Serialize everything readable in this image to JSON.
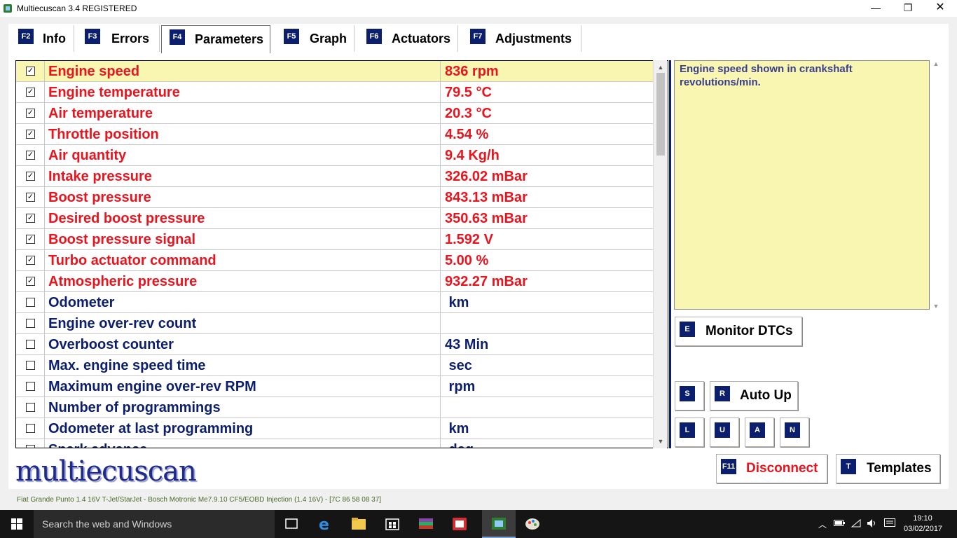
{
  "window": {
    "title": "Multiecuscan 3.4 REGISTERED",
    "min_glyph": "—",
    "max_glyph": "❐",
    "close_glyph": "✕"
  },
  "tabs": [
    {
      "key": "F2",
      "label": "Info",
      "active": false
    },
    {
      "key": "F3",
      "label": "Errors",
      "active": false
    },
    {
      "key": "F4",
      "label": "Parameters",
      "active": true
    },
    {
      "key": "F5",
      "label": "Graph",
      "active": false
    },
    {
      "key": "F6",
      "label": "Actuators",
      "active": false
    },
    {
      "key": "F7",
      "label": "Adjustments",
      "active": false
    }
  ],
  "parameters": [
    {
      "name": "Engine speed",
      "value": "836 rpm",
      "checked": true
    },
    {
      "name": "Engine temperature",
      "value": "79.5 °C",
      "checked": true
    },
    {
      "name": "Air temperature",
      "value": "20.3 °C",
      "checked": true
    },
    {
      "name": "Throttle position",
      "value": "4.54 %",
      "checked": true
    },
    {
      "name": "Air quantity",
      "value": "9.4 Kg/h",
      "checked": true
    },
    {
      "name": "Intake pressure",
      "value": "326.02 mBar",
      "checked": true
    },
    {
      "name": "Boost pressure",
      "value": "843.13 mBar",
      "checked": true
    },
    {
      "name": "Desired boost pressure",
      "value": "350.63 mBar",
      "checked": true
    },
    {
      "name": "Boost pressure signal",
      "value": "1.592 V",
      "checked": true
    },
    {
      "name": "Turbo actuator command",
      "value": "5.00 %",
      "checked": true
    },
    {
      "name": "Atmospheric pressure",
      "value": "932.27 mBar",
      "checked": true
    },
    {
      "name": "Odometer",
      "value": " km",
      "checked": false
    },
    {
      "name": "Engine over-rev count",
      "value": "",
      "checked": false
    },
    {
      "name": "Overboost counter",
      "value": "43 Min",
      "checked": false
    },
    {
      "name": "Max. engine speed time",
      "value": " sec",
      "checked": false
    },
    {
      "name": "Maximum engine over-rev RPM",
      "value": " rpm",
      "checked": false
    },
    {
      "name": "Number of programmings",
      "value": "",
      "checked": false
    },
    {
      "name": "Odometer at last programming",
      "value": " km",
      "checked": false
    },
    {
      "name": "Spark advance",
      "value": " deg",
      "checked": false
    }
  ],
  "selected_parameter_index": 0,
  "description": "Engine speed shown in crankshaft revolutions/min.",
  "buttons": {
    "monitor_dtcs": {
      "key": "E",
      "label": "Monitor DTCs"
    },
    "s": {
      "key": "S"
    },
    "auto_up": {
      "key": "R",
      "label": "Auto Up"
    },
    "l": {
      "key": "L"
    },
    "u": {
      "key": "U"
    },
    "a": {
      "key": "A"
    },
    "n": {
      "key": "N"
    },
    "disconnect": {
      "key": "F11",
      "label": "Disconnect"
    },
    "templates": {
      "key": "T",
      "label": "Templates"
    }
  },
  "logo_text": "multiecuscan",
  "status_text": "Fiat Grande Punto 1.4 16V T-Jet/StarJet - Bosch Motronic Me7.9.10 CF5/EOBD Injection (1.4 16V) - [7C 86 58 08 37]",
  "taskbar": {
    "search_placeholder": "Search the web and Windows",
    "time": "19:10",
    "date": "03/02/2017"
  },
  "colors": {
    "active_param": "#e8141e",
    "inactive_param": "#0c1e6e",
    "selected_row": "#f8f6b0",
    "fkey_badge": "#0c1e6e",
    "disconnect_label": "#e8141e"
  }
}
